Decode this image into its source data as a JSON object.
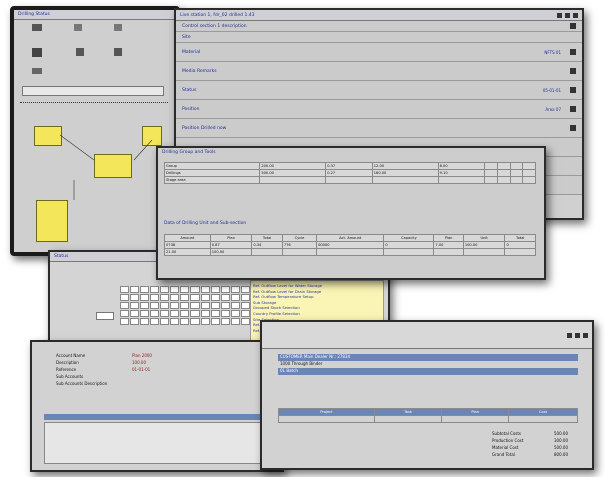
{
  "left_window": {
    "title": "Drilling Status"
  },
  "main_window": {
    "title": "Live station 1, fdr_02 drilled 1.43",
    "rows": [
      {
        "label": "Control section 1 description",
        "value": ""
      },
      {
        "label": "Site",
        "value": ""
      },
      {
        "label": "Material",
        "value": "NFTS 01"
      },
      {
        "label": "Media Remarks",
        "value": ""
      },
      {
        "label": "Status",
        "value": "05-01-01"
      },
      {
        "label": "Position",
        "value": "Area 07"
      },
      {
        "label": "Position Drilled now",
        "value": ""
      }
    ]
  },
  "drilling_window": {
    "section1": "Drilling Group and Tools",
    "section2": "Data of Drilling Unit and Sub-section",
    "row_labels": [
      "Group",
      "Drillings",
      "Stage area"
    ],
    "values_a": [
      "200.00",
      "0.37",
      "12.00",
      "8.00"
    ],
    "values_b": [
      "500.00",
      "0.27",
      "160.00",
      "9.10"
    ],
    "sub_headers": [
      "Amount",
      "Plan",
      "Total",
      "Cycle",
      "Act. Amount",
      "Capacity",
      "Plan",
      "Unit",
      "Total"
    ],
    "sub_values": [
      "0738",
      "0.87",
      "0.34",
      "776",
      "00000",
      "0",
      "7.00",
      "100.00",
      "0",
      "21.00",
      "100.00"
    ]
  },
  "yellow_list": {
    "items": [
      "Ref. Outflow Level for Water Storage",
      "Ref. Outflow Level for Drain Storage",
      "Ref. Outflow Temperature Setup",
      "Sub Storage",
      "Grouped Stock Selection",
      "Country Profile Selection",
      "Site Selection",
      "Ref. Selection",
      "Ref. Selection"
    ]
  },
  "table_window": {
    "title": "Status"
  },
  "bottom_left_window": {
    "fields": [
      "Account Name",
      "Description",
      "Reference",
      "Sub Accounts",
      "Sub Accounts Description"
    ],
    "values": [
      "Plan 2000",
      "100.00",
      "01-01-01"
    ]
  },
  "bottom_right_window": {
    "rows": [
      "CUSTOMER Main Dealer Nr.: 27834",
      "1000 Through Binder",
      "01 Batch"
    ],
    "header": [
      "Project",
      "Task",
      "Plan",
      "Cost"
    ],
    "totals": [
      "Subtotal Costs",
      "Production Cost",
      "Material Cost",
      "Grand Total"
    ],
    "total_values": [
      "500.00",
      "300.00",
      "500.00",
      "800.00"
    ]
  }
}
